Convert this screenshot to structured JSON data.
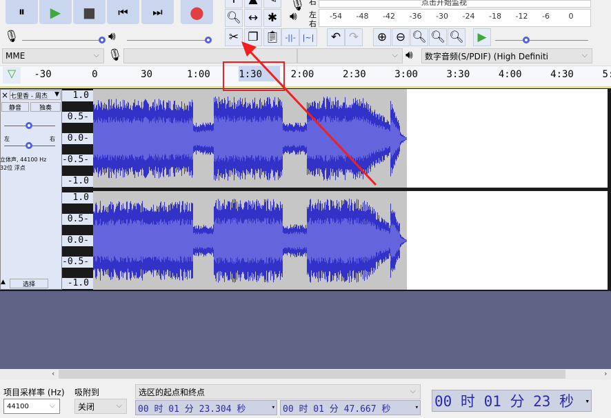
{
  "transport": {
    "pause": "⏸",
    "play": "▶",
    "stop": "■",
    "skip_start": "⏮",
    "skip_end": "⏭",
    "record": "●"
  },
  "meter": {
    "monitor_hint": "点击开始监视",
    "left": "左",
    "right": "右",
    "ticks": [
      "-54",
      "-48",
      "-42",
      "-36",
      "-30",
      "-24",
      "-18",
      "-12",
      "-6",
      "0"
    ]
  },
  "sliders": {
    "minus": "-",
    "plus": "+",
    "record_volume": 0.97,
    "playback_volume": 0.97,
    "play_speed": 0.33
  },
  "devices": {
    "host": "MME",
    "input": "",
    "channels": "",
    "output": "数字音频(S/PDIF) (High Definiti"
  },
  "ruler": {
    "ticks": [
      "-30",
      "0",
      "30",
      "1:00",
      "1:30",
      "2:00",
      "2:30",
      "3:00",
      "3:30",
      "4:00",
      "4:30",
      "5:00"
    ],
    "selection_start_sec": 83.304,
    "selection_end_sec": 107.667
  },
  "track": {
    "close": "×",
    "name": "七里香 - 周杰",
    "mute": "静音",
    "solo": "独奏",
    "gain": 0.5,
    "pan_left": "左",
    "pan_right": "右",
    "pan": 0.5,
    "info1": "立体声, 44100 Hz",
    "info2": "32位 浮点",
    "select": "选择",
    "scale": [
      "1.0",
      "0.5-",
      "0.0-",
      "-0.5-",
      "-1.0"
    ],
    "duration_sec": 182
  },
  "bottom": {
    "rate_label": "项目采样率 (Hz)",
    "rate_value": "44100",
    "snap_label": "吸附到",
    "snap_value": "关闭",
    "selection_mode": "选区的起点和终点",
    "start_time": "00 时 01 分 23.304 秒",
    "end_time": "00 时 01 分 47.667 秒",
    "position": "00 时 01 分 23 秒"
  },
  "colors": {
    "wave": "#3232c8",
    "wave_rms": "#6464dc",
    "clip_bg": "#c6c6c6",
    "empty_bg": "#5f6386",
    "annotation": "#f02020"
  }
}
